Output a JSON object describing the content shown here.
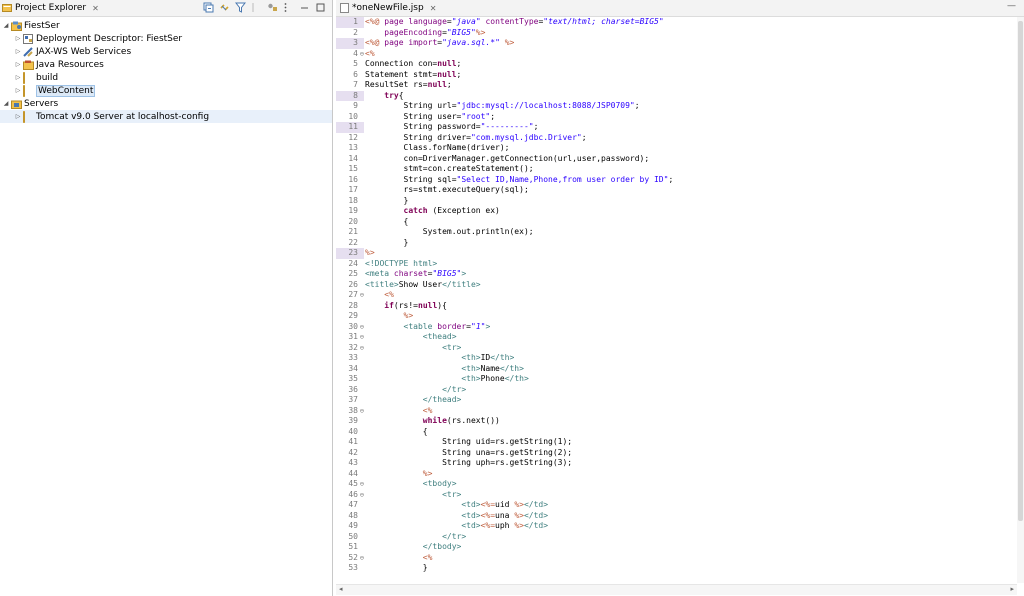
{
  "explorer": {
    "title": "Project Explorer",
    "close_glyph": "✕",
    "tree": [
      {
        "label": "FiestSer",
        "level": 0,
        "expand": "open",
        "icon": "project-icon"
      },
      {
        "label": "Deployment Descriptor: FiestSer",
        "level": 1,
        "expand": "closed",
        "icon": "deployment-descriptor-icon"
      },
      {
        "label": "JAX-WS Web Services",
        "level": 1,
        "expand": "closed",
        "icon": "web-services-icon"
      },
      {
        "label": "Java Resources",
        "level": 1,
        "expand": "closed",
        "icon": "java-resources-icon"
      },
      {
        "label": "build",
        "level": 1,
        "expand": "closed",
        "icon": "folder-icon"
      },
      {
        "label": "WebContent",
        "level": 1,
        "expand": "closed",
        "icon": "folder-icon",
        "selected": true
      },
      {
        "label": "Servers",
        "level": 0,
        "expand": "open",
        "icon": "folder-icon"
      },
      {
        "label": "Tomcat v9.0 Server at localhost-config",
        "level": 1,
        "expand": "closed",
        "icon": "folder-icon",
        "highlight": true
      }
    ]
  },
  "editor": {
    "tab_title": "*oneNewFile.jsp",
    "close_glyph": "✕",
    "minimize": "—",
    "maximize": "□",
    "lines": [
      {
        "n": 1,
        "fold": "",
        "mark": true,
        "html": "<span class=\"d\">&lt;%@</span> <span class=\"a\">page</span> <span class=\"a\">language</span>=<span class=\"v\">\"java\"</span> <span class=\"a\">contentType</span>=<span class=\"v\">\"text/html; charset=BIG5\"</span>"
      },
      {
        "n": 2,
        "fold": "",
        "mark": false,
        "html": "    <span class=\"a\">pageEncoding</span>=<span class=\"v\">\"BIG5\"</span><span class=\"d\">%&gt;</span>"
      },
      {
        "n": 3,
        "fold": "",
        "mark": true,
        "html": "<span class=\"d\">&lt;%@</span> <span class=\"a\">page</span> <span class=\"a\">import</span>=<span class=\"v\">\"java.sql.*\"</span> <span class=\"d\">%&gt;</span>"
      },
      {
        "n": 4,
        "fold": "⊖",
        "mark": false,
        "html": "<span class=\"d\">&lt;%</span>"
      },
      {
        "n": 5,
        "fold": "",
        "mark": false,
        "html": "Connection con=<span class=\"k\">null</span>;"
      },
      {
        "n": 6,
        "fold": "",
        "mark": false,
        "html": "Statement stmt=<span class=\"k\">null</span>;"
      },
      {
        "n": 7,
        "fold": "",
        "mark": false,
        "html": "ResultSet rs=<span class=\"k\">null</span>;"
      },
      {
        "n": 8,
        "fold": "",
        "mark": true,
        "html": "    <span class=\"k\">try</span>{"
      },
      {
        "n": 9,
        "fold": "",
        "mark": false,
        "html": "        String url=<span class=\"s\">\"jdbc:mysql://localhost:8088/JSP0709\"</span>;"
      },
      {
        "n": 10,
        "fold": "",
        "mark": false,
        "html": "        String user=<span class=\"s\">\"root\"</span>;"
      },
      {
        "n": 11,
        "fold": "",
        "mark": true,
        "html": "        String password=<span class=\"s\">\"---------\"</span>;"
      },
      {
        "n": 12,
        "fold": "",
        "mark": false,
        "html": "        String driver=<span class=\"s\">\"com.mysql.jdbc.Driver\"</span>;"
      },
      {
        "n": 13,
        "fold": "",
        "mark": false,
        "html": "        Class.forName(driver);"
      },
      {
        "n": 14,
        "fold": "",
        "mark": false,
        "html": "        con=DriverManager.getConnection(url,user,password);"
      },
      {
        "n": 15,
        "fold": "",
        "mark": false,
        "html": "        stmt=con.createStatement();"
      },
      {
        "n": 16,
        "fold": "",
        "mark": false,
        "html": "        String sql=<span class=\"s\">\"Select ID,Name,Phone,from user order by ID\"</span>;"
      },
      {
        "n": 17,
        "fold": "",
        "mark": false,
        "html": "        rs=stmt.executeQuery(sql);"
      },
      {
        "n": 18,
        "fold": "",
        "mark": false,
        "html": "        }"
      },
      {
        "n": 19,
        "fold": "",
        "mark": false,
        "html": "        <span class=\"k\">catch</span> (Exception ex)"
      },
      {
        "n": 20,
        "fold": "",
        "mark": false,
        "html": "        {"
      },
      {
        "n": 21,
        "fold": "",
        "mark": false,
        "html": "            System.out.println(ex);"
      },
      {
        "n": 22,
        "fold": "",
        "mark": false,
        "html": "        }"
      },
      {
        "n": 23,
        "fold": "",
        "mark": true,
        "html": "<span class=\"d\">%&gt;</span>"
      },
      {
        "n": 24,
        "fold": "",
        "mark": false,
        "html": "<span class=\"t\">&lt;!DOCTYPE html&gt;</span>"
      },
      {
        "n": 25,
        "fold": "",
        "mark": false,
        "html": "<span class=\"t\">&lt;meta</span> <span class=\"a\">charset</span>=<span class=\"v\">\"BIG5\"</span><span class=\"t\">&gt;</span>"
      },
      {
        "n": 26,
        "fold": "",
        "mark": false,
        "html": "<span class=\"t\">&lt;title&gt;</span>Show User<span class=\"t\">&lt;/title&gt;</span>"
      },
      {
        "n": 27,
        "fold": "⊖",
        "mark": false,
        "html": "    <span class=\"d\">&lt;%</span>"
      },
      {
        "n": 28,
        "fold": "",
        "mark": false,
        "html": "    <span class=\"k\">if</span>(rs!=<span class=\"k\">null</span>){"
      },
      {
        "n": 29,
        "fold": "",
        "mark": false,
        "html": "        <span class=\"d\">%&gt;</span>"
      },
      {
        "n": 30,
        "fold": "⊖",
        "mark": false,
        "html": "        <span class=\"t\">&lt;table</span> <span class=\"a\">border</span>=<span class=\"v\">\"1\"</span><span class=\"t\">&gt;</span>"
      },
      {
        "n": 31,
        "fold": "⊖",
        "mark": false,
        "html": "            <span class=\"t\">&lt;thead&gt;</span>"
      },
      {
        "n": 32,
        "fold": "⊖",
        "mark": false,
        "html": "                <span class=\"t\">&lt;tr&gt;</span>"
      },
      {
        "n": 33,
        "fold": "",
        "mark": false,
        "html": "                    <span class=\"t\">&lt;th&gt;</span>ID<span class=\"t\">&lt;/th&gt;</span>"
      },
      {
        "n": 34,
        "fold": "",
        "mark": false,
        "html": "                    <span class=\"t\">&lt;th&gt;</span>Name<span class=\"t\">&lt;/th&gt;</span>"
      },
      {
        "n": 35,
        "fold": "",
        "mark": false,
        "html": "                    <span class=\"t\">&lt;th&gt;</span>Phone<span class=\"t\">&lt;/th&gt;</span>"
      },
      {
        "n": 36,
        "fold": "",
        "mark": false,
        "html": "                <span class=\"t\">&lt;/tr&gt;</span>"
      },
      {
        "n": 37,
        "fold": "",
        "mark": false,
        "html": "            <span class=\"t\">&lt;/thead&gt;</span>"
      },
      {
        "n": 38,
        "fold": "⊖",
        "mark": false,
        "html": "            <span class=\"d\">&lt;%</span>"
      },
      {
        "n": 39,
        "fold": "",
        "mark": false,
        "html": "            <span class=\"k\">while</span>(rs.next())"
      },
      {
        "n": 40,
        "fold": "",
        "mark": false,
        "html": "            {"
      },
      {
        "n": 41,
        "fold": "",
        "mark": false,
        "html": "                String uid=rs.getString(1);"
      },
      {
        "n": 42,
        "fold": "",
        "mark": false,
        "html": "                String una=rs.getString(2);"
      },
      {
        "n": 43,
        "fold": "",
        "mark": false,
        "html": "                String uph=rs.getString(3);"
      },
      {
        "n": 44,
        "fold": "",
        "mark": false,
        "html": "            <span class=\"d\">%&gt;</span>"
      },
      {
        "n": 45,
        "fold": "⊖",
        "mark": false,
        "html": "            <span class=\"t\">&lt;tbody&gt;</span>"
      },
      {
        "n": 46,
        "fold": "⊖",
        "mark": false,
        "html": "                <span class=\"t\">&lt;tr&gt;</span>"
      },
      {
        "n": 47,
        "fold": "",
        "mark": false,
        "html": "                    <span class=\"t\">&lt;td&gt;</span><span class=\"d\">&lt;%=</span>uid <span class=\"d\">%&gt;</span><span class=\"t\">&lt;/td&gt;</span>"
      },
      {
        "n": 48,
        "fold": "",
        "mark": false,
        "html": "                    <span class=\"t\">&lt;td&gt;</span><span class=\"d\">&lt;%=</span>una <span class=\"d\">%&gt;</span><span class=\"t\">&lt;/td&gt;</span>"
      },
      {
        "n": 49,
        "fold": "",
        "mark": false,
        "html": "                    <span class=\"t\">&lt;td&gt;</span><span class=\"d\">&lt;%=</span>uph <span class=\"d\">%&gt;</span><span class=\"t\">&lt;/td&gt;</span>"
      },
      {
        "n": 50,
        "fold": "",
        "mark": false,
        "html": "                <span class=\"t\">&lt;/tr&gt;</span>"
      },
      {
        "n": 51,
        "fold": "",
        "mark": false,
        "html": "            <span class=\"t\">&lt;/tbody&gt;</span>"
      },
      {
        "n": 52,
        "fold": "⊖",
        "mark": false,
        "html": "            <span class=\"d\">&lt;%</span>"
      },
      {
        "n": 53,
        "fold": "",
        "mark": false,
        "html": "            }"
      }
    ]
  }
}
